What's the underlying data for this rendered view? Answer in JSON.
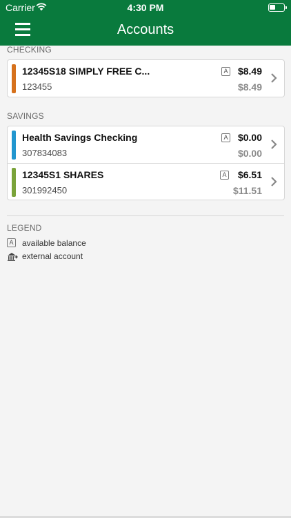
{
  "status": {
    "carrier": "Carrier",
    "time": "4:30 PM"
  },
  "header": {
    "title": "Accounts"
  },
  "checking": {
    "label": "CHECKING",
    "accounts": [
      {
        "name": "12345S18 SIMPLY FREE C...",
        "number": "123455",
        "badge": "A",
        "available": "$8.49",
        "current": "$8.49",
        "accent": "#d6711c"
      }
    ]
  },
  "savings": {
    "label": "SAVINGS",
    "accounts": [
      {
        "name": "Health Savings Checking",
        "number": "307834083",
        "badge": "A",
        "available": "$0.00",
        "current": "$0.00",
        "accent": "#2196cf"
      },
      {
        "name": "12345S1 SHARES",
        "number": "301992450",
        "badge": "A",
        "available": "$6.51",
        "current": "$11.51",
        "accent": "#7aa33a"
      }
    ]
  },
  "legend": {
    "label": "LEGEND",
    "items": [
      {
        "icon": "available-balance-icon",
        "badge": "A",
        "text": "available balance"
      },
      {
        "icon": "external-account-icon",
        "text": "external account"
      }
    ]
  }
}
